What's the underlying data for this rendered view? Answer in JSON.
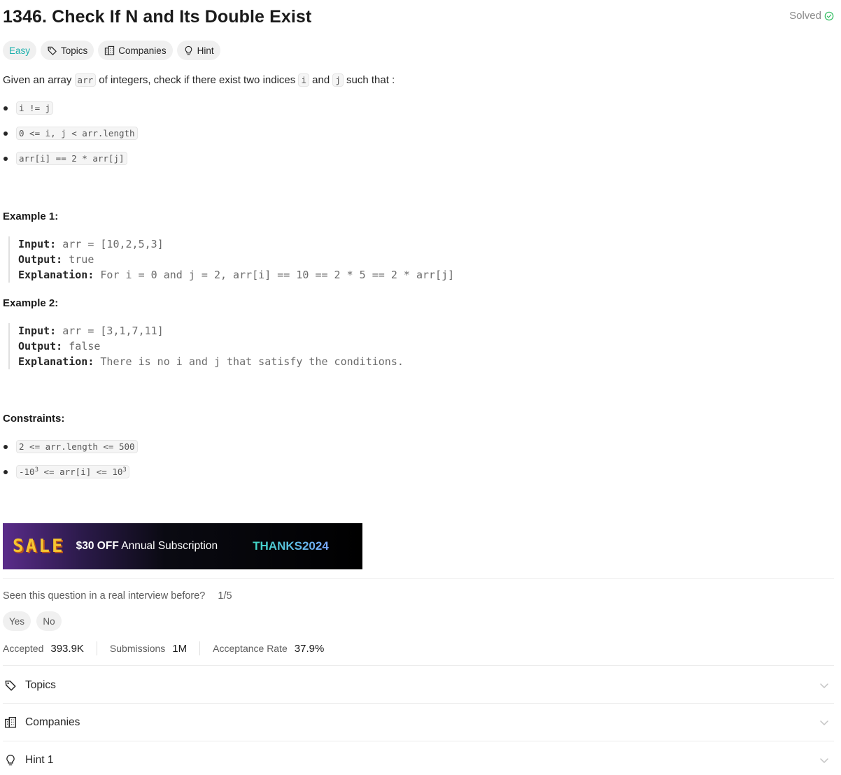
{
  "problem": {
    "title": "1346. Check If N and Its Double Exist",
    "status": "Solved"
  },
  "tags": {
    "difficulty": "Easy",
    "topics": "Topics",
    "companies": "Companies",
    "hint": "Hint"
  },
  "description": {
    "part1": "Given an array ",
    "code_arr": "arr",
    "part2": " of integers, check if there exist two indices ",
    "code_i": "i",
    "part3": " and ",
    "code_j": "j",
    "part4": " such that :",
    "bullets": [
      "i != j",
      "0 <= i, j < arr.length",
      "arr[i] == 2 * arr[j]"
    ]
  },
  "examples": [
    {
      "heading": "Example 1:",
      "input_label": "Input:",
      "input": "arr = [10,2,5,3]",
      "output_label": "Output:",
      "output": "true",
      "explanation_label": "Explanation:",
      "explanation": "For i = 0 and j = 2, arr[i] == 10 == 2 * 5 == 2 * arr[j]"
    },
    {
      "heading": "Example 2:",
      "input_label": "Input:",
      "input": "arr = [3,1,7,11]",
      "output_label": "Output:",
      "output": "false",
      "explanation_label": "Explanation:",
      "explanation": "There is no i and j that satisfy the conditions."
    }
  ],
  "constraints": {
    "heading": "Constraints:",
    "c1": "2 <= arr.length <= 500",
    "c2_a": "-10",
    "c2_sup1": "3",
    "c2_b": " <= arr[i] <= 10",
    "c2_sup2": "3"
  },
  "banner": {
    "sale": "SALE",
    "off": "$30 OFF",
    "subscription": " Annual Subscription",
    "code": "THANKS2024"
  },
  "interview": {
    "question": "Seen this question in a real interview before?",
    "fraction": "1/5",
    "yes": "Yes",
    "no": "No"
  },
  "stats": {
    "accepted_label": "Accepted",
    "accepted": "393.9K",
    "submissions_label": "Submissions",
    "submissions": "1M",
    "rate_label": "Acceptance Rate",
    "rate": "37.9%"
  },
  "accordions": {
    "topics": "Topics",
    "companies": "Companies",
    "hint1": "Hint 1"
  },
  "colors": {
    "easy": "#1fb0ad",
    "solved_check": "#2cbb5d",
    "sale": "#f5c531"
  },
  "icons": [
    "check-circle-icon",
    "tag-icon",
    "building-icon",
    "lightbulb-icon",
    "chevron-down-icon"
  ]
}
